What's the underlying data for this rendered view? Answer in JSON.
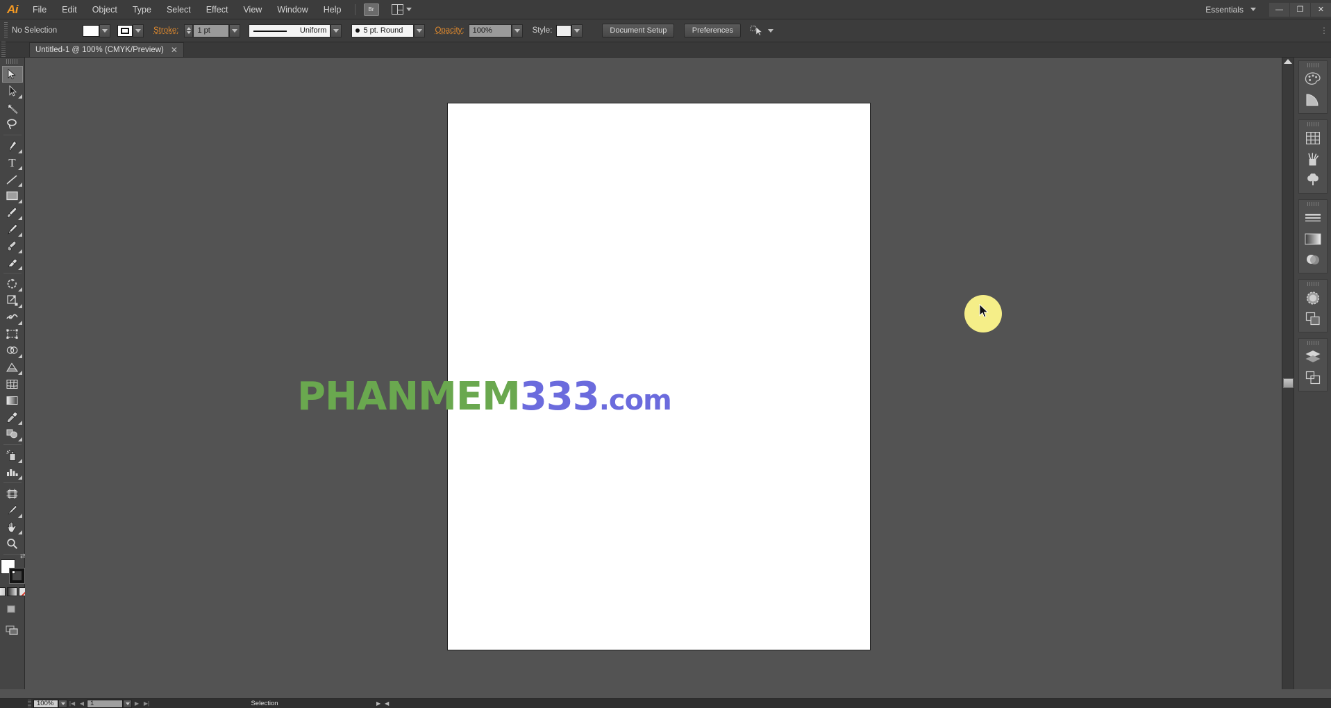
{
  "app": {
    "logo": "Ai",
    "workspace": "Essentials",
    "window_buttons": {
      "minimize": "—",
      "restore": "❐",
      "close": "✕"
    }
  },
  "menu": {
    "items": [
      "File",
      "Edit",
      "Object",
      "Type",
      "Select",
      "Effect",
      "View",
      "Window",
      "Help"
    ],
    "bridge_label": "Br"
  },
  "control_bar": {
    "selection_state": "No Selection",
    "stroke_label": "Stroke:",
    "stroke_weight": "1 pt",
    "stroke_profile": "Uniform",
    "brush": "5 pt. Round",
    "opacity_label": "Opacity:",
    "opacity_value": "100%",
    "style_label": "Style:",
    "document_setup_button": "Document Setup",
    "preferences_button": "Preferences"
  },
  "document_tab": {
    "title": "Untitled-1 @ 100% (CMYK/Preview)",
    "close": "✕"
  },
  "tools": [
    {
      "name": "selection-tool",
      "label": "Selection",
      "active": true,
      "more": false
    },
    {
      "name": "direct-selection-tool",
      "label": "Direct Selection",
      "active": false,
      "more": true
    },
    {
      "name": "magic-wand-tool",
      "label": "Magic Wand",
      "active": false,
      "more": false
    },
    {
      "name": "lasso-tool",
      "label": "Lasso",
      "active": false,
      "more": false
    },
    {
      "name": "pen-tool",
      "label": "Pen",
      "active": false,
      "more": true
    },
    {
      "name": "type-tool",
      "label": "Type",
      "active": false,
      "more": true
    },
    {
      "name": "line-segment-tool",
      "label": "Line Segment",
      "active": false,
      "more": true
    },
    {
      "name": "rectangle-tool",
      "label": "Rectangle",
      "active": false,
      "more": true
    },
    {
      "name": "paintbrush-tool",
      "label": "Paintbrush",
      "active": false,
      "more": true
    },
    {
      "name": "pencil-tool",
      "label": "Pencil",
      "active": false,
      "more": true
    },
    {
      "name": "blob-brush-tool",
      "label": "Blob Brush",
      "active": false,
      "more": true
    },
    {
      "name": "eraser-tool",
      "label": "Eraser",
      "active": false,
      "more": true
    },
    {
      "name": "rotate-tool",
      "label": "Rotate",
      "active": false,
      "more": true
    },
    {
      "name": "scale-tool",
      "label": "Scale",
      "active": false,
      "more": true
    },
    {
      "name": "width-tool",
      "label": "Width",
      "active": false,
      "more": true
    },
    {
      "name": "free-transform-tool",
      "label": "Free Transform",
      "active": false,
      "more": false
    },
    {
      "name": "shape-builder-tool",
      "label": "Shape Builder",
      "active": false,
      "more": true
    },
    {
      "name": "perspective-grid-tool",
      "label": "Perspective Grid",
      "active": false,
      "more": true
    },
    {
      "name": "mesh-tool",
      "label": "Mesh",
      "active": false,
      "more": false
    },
    {
      "name": "gradient-tool",
      "label": "Gradient",
      "active": false,
      "more": false
    },
    {
      "name": "eyedropper-tool",
      "label": "Eyedropper",
      "active": false,
      "more": true
    },
    {
      "name": "blend-tool",
      "label": "Blend",
      "active": false,
      "more": true
    },
    {
      "name": "symbol-sprayer-tool",
      "label": "Symbol Sprayer",
      "active": false,
      "more": true
    },
    {
      "name": "column-graph-tool",
      "label": "Column Graph",
      "active": false,
      "more": true
    },
    {
      "name": "artboard-tool",
      "label": "Artboard",
      "active": false,
      "more": false
    },
    {
      "name": "slice-tool",
      "label": "Slice",
      "active": false,
      "more": true
    },
    {
      "name": "hand-tool",
      "label": "Hand",
      "active": false,
      "more": true
    },
    {
      "name": "zoom-tool",
      "label": "Zoom",
      "active": false,
      "more": false
    }
  ],
  "tool_footer": {
    "fill_color": "#ffffff",
    "stroke_color": "#141414",
    "color_mode": "Color",
    "gradient_mode": "Gradient",
    "none_mode": "None",
    "draw_mode": "Draw Normal",
    "screen_mode": "Change Screen Mode"
  },
  "right_dock": {
    "groups": [
      [
        {
          "name": "color-panel-icon",
          "label": "Color"
        },
        {
          "name": "color-guide-panel-icon",
          "label": "Color Guide"
        }
      ],
      [
        {
          "name": "swatches-panel-icon",
          "label": "Swatches"
        },
        {
          "name": "brushes-panel-icon",
          "label": "Brushes"
        },
        {
          "name": "symbols-panel-icon",
          "label": "Symbols"
        }
      ],
      [
        {
          "name": "stroke-panel-icon",
          "label": "Stroke"
        },
        {
          "name": "gradient-panel-icon",
          "label": "Gradient"
        },
        {
          "name": "transparency-panel-icon",
          "label": "Transparency"
        }
      ],
      [
        {
          "name": "appearance-panel-icon",
          "label": "Appearance"
        },
        {
          "name": "graphic-styles-panel-icon",
          "label": "Graphic Styles"
        }
      ],
      [
        {
          "name": "layers-panel-icon",
          "label": "Layers"
        },
        {
          "name": "artboards-panel-icon",
          "label": "Artboards"
        }
      ]
    ]
  },
  "status_bar": {
    "zoom_level": "100%",
    "artboard_number": "1",
    "status_text": "Selection",
    "first_nav": "|◀",
    "prev_nav": "◀",
    "next_nav": "▶",
    "last_nav": "▶|"
  },
  "canvas": {
    "watermark": {
      "part1": "PHANMEM",
      "part2": "333",
      "part3": ".com",
      "color1": "#6aa84f",
      "color2": "#6b6bdd"
    },
    "artboard_color": "#ffffff",
    "background_color": "#535353",
    "click_indicator_color": "#f5ee88"
  }
}
